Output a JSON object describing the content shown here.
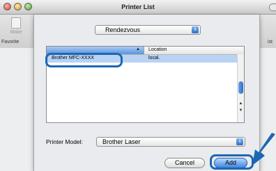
{
  "window": {
    "title": "Printer List"
  },
  "toolbar": {
    "make_label": "Make"
  },
  "background_columns": {
    "left_header": "Favorite",
    "right_header": "ist"
  },
  "dialog": {
    "service_popup": {
      "value": "Rendezvous",
      "arrow": "updown-arrows-icon"
    },
    "list": {
      "columns": [
        "",
        "Location"
      ],
      "rows": [
        {
          "name": "Brother  MFC-XXXX",
          "location": "local."
        }
      ]
    },
    "printer_model": {
      "label": "Printer Model:",
      "value": "Brother Laser"
    },
    "buttons": {
      "cancel": "Cancel",
      "add": "Add"
    }
  },
  "colors": {
    "highlight": "#1b67b3",
    "selection": "#b9d3f5",
    "default_button": "#3e86e0"
  }
}
